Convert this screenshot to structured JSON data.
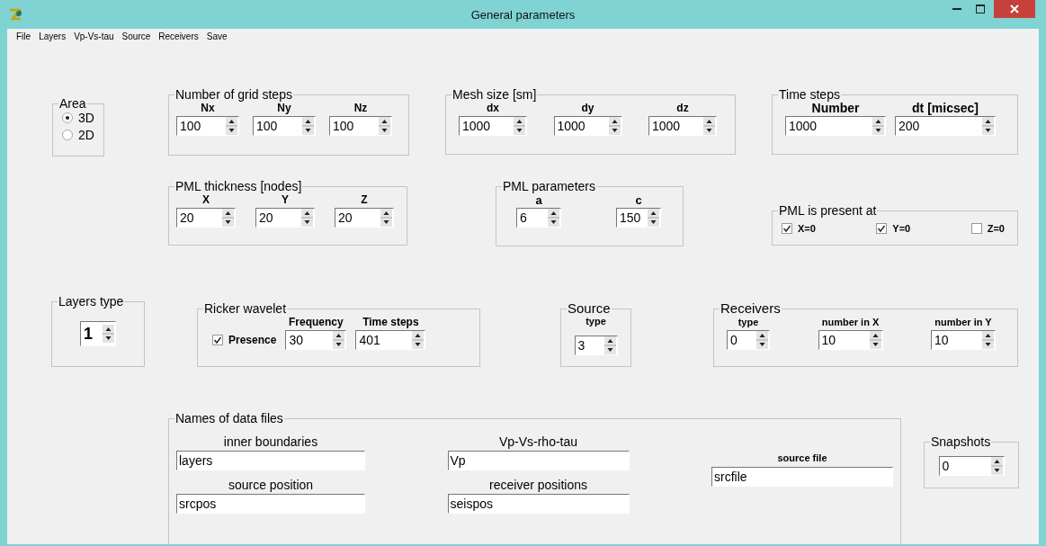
{
  "window": {
    "title": "General parameters"
  },
  "menu": [
    {
      "label": "File"
    },
    {
      "label": "Layers"
    },
    {
      "label": "Vp-Vs-tau"
    },
    {
      "label": "Source"
    },
    {
      "label": "Receivers"
    },
    {
      "label": "Save"
    }
  ],
  "rows": [
    {
      "groups": [
        {
          "title": "Area",
          "items": [
            {
              "kind": "radio",
              "label": "3D",
              "selected": true
            },
            {
              "kind": "radio",
              "label": "2D",
              "selected": false
            }
          ]
        },
        {
          "title": "Number of grid steps",
          "items": [
            {
              "kind": "spin",
              "label": "Nx",
              "value": "100"
            },
            {
              "kind": "spin",
              "label": "Ny",
              "value": "100"
            },
            {
              "kind": "spin",
              "label": "Nz",
              "value": "100"
            }
          ]
        },
        {
          "title": "Mesh size [sm]",
          "items": [
            {
              "kind": "spin",
              "label": "dx",
              "value": "1000"
            },
            {
              "kind": "spin",
              "label": "dy",
              "value": "1000"
            },
            {
              "kind": "spin",
              "label": "dz",
              "value": "1000"
            }
          ]
        },
        {
          "title": "Time steps",
          "items": [
            {
              "kind": "spin",
              "label": "Number",
              "value": "1000"
            },
            {
              "kind": "spin",
              "label": "dt [micsec]",
              "value": "200"
            }
          ]
        }
      ]
    },
    {
      "groups": [
        {
          "title": "PML thickness [nodes]",
          "items": [
            {
              "kind": "spin",
              "label": "X",
              "value": "20"
            },
            {
              "kind": "spin",
              "label": "Y",
              "value": "20"
            },
            {
              "kind": "spin",
              "label": "Z",
              "value": "20"
            }
          ]
        },
        {
          "title": "PML parameters",
          "items": [
            {
              "kind": "spin",
              "label": "a",
              "value": "6"
            },
            {
              "kind": "spin",
              "label": "c",
              "value": "150"
            }
          ]
        },
        {
          "title": "PML is present at",
          "items": [
            {
              "kind": "check",
              "label": "X=0",
              "checked": true
            },
            {
              "kind": "check",
              "label": "Y=0",
              "checked": true
            },
            {
              "kind": "check",
              "label": "Z=0",
              "checked": false
            }
          ]
        }
      ]
    },
    {
      "groups": [
        {
          "title": "Layers type",
          "items": [
            {
              "kind": "spin",
              "value": "1"
            }
          ]
        },
        {
          "title": "Ricker wavelet",
          "items": [
            {
              "kind": "check",
              "label": "Presence",
              "checked": true
            },
            {
              "kind": "spin",
              "label": "Frequency",
              "value": "30"
            },
            {
              "kind": "spin",
              "label": "Time steps",
              "value": "401"
            }
          ]
        },
        {
          "title": "Source",
          "items": [
            {
              "kind": "spin",
              "label": "type",
              "value": "3"
            }
          ]
        },
        {
          "title": "Receivers",
          "items": [
            {
              "kind": "spin",
              "label": "type",
              "value": "0"
            },
            {
              "kind": "spin",
              "label": "number in X",
              "value": "10"
            },
            {
              "kind": "spin",
              "label": "number in Y",
              "value": "10"
            }
          ]
        }
      ]
    },
    {
      "groups": [
        {
          "title": "Names of data files",
          "items": [
            {
              "kind": "text",
              "label": "inner boundaries",
              "value": "layers"
            },
            {
              "kind": "text",
              "label": "Vp-Vs-rho-tau",
              "value": "Vp"
            },
            {
              "kind": "text",
              "label": "source file",
              "value": "srcfile"
            },
            {
              "kind": "text",
              "label": "source position",
              "value": "srcpos"
            },
            {
              "kind": "text",
              "label": "receiver positions",
              "value": "seispos"
            }
          ]
        },
        {
          "title": "Snapshots",
          "items": [
            {
              "kind": "spin",
              "value": "0"
            }
          ]
        }
      ]
    }
  ]
}
